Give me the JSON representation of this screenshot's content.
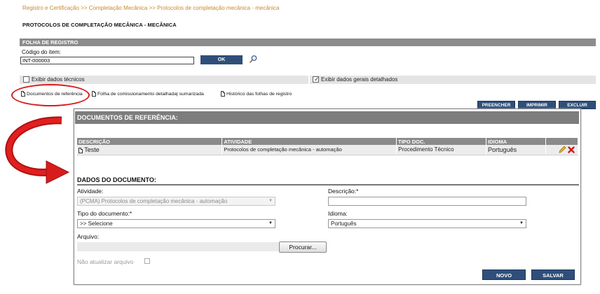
{
  "breadcrumb": {
    "item1": "Registro e Certificação",
    "sep": ">>",
    "item2": "Completação Mecânica",
    "item3": "Protocolos de completação mecânica - mecânica"
  },
  "page_title": "PROTOCOLOS DE COMPLETAÇÃO MECÂNICA - MECÂNICA",
  "folha": {
    "title": "FOLHA DE REGISTRO",
    "codigo_label": "Código do item:",
    "codigo_value": "INT-000003",
    "ok_label": "OK"
  },
  "options": {
    "tech_label": "Exibir dados técnicos",
    "tech_checked": false,
    "general_label": "Exibir dados gerais detalhados",
    "general_checked": true
  },
  "tabs": [
    {
      "label": "Documentos de referência"
    },
    {
      "label": "Folha de comissionamento detalhada| sumarizada"
    },
    {
      "label": "Histórico das folhas de registro"
    }
  ],
  "actions": {
    "preencher": "PREENCHER",
    "imprimir": "IMPRIMIR",
    "excluir": "EXCLUIR"
  },
  "panel": {
    "title": "DOCUMENTOS DE REFERÊNCIA:",
    "columns": [
      "DESCRIÇÃO",
      "ATIVIDADE",
      "TIPO DOC.",
      "IDIOMA"
    ],
    "rows": [
      {
        "descricao": "Teste",
        "atividade": "Protocolos de completação mecânica - automação",
        "tipo": "Procedimento Técnico",
        "idioma": "Português"
      }
    ]
  },
  "dados": {
    "title": "DADOS DO DOCUMENTO:",
    "atividade_label": "Atividade:",
    "atividade_value": "(PCMA) Protocolos de completação mecânica - automação",
    "descricao_label": "Descrição:*",
    "descricao_value": "",
    "tipo_label": "Tipo do documento:*",
    "tipo_value": ">> Selecione",
    "idioma_label": "Idioma:",
    "idioma_value": "Português",
    "arquivo_label": "Arquivo:",
    "procurar_label": "Procurar...",
    "nao_atualizar_label": "Não atualizar arquivo",
    "novo_label": "NOVO",
    "salvar_label": "SALVAR"
  },
  "colors": {
    "breadcrumb": "#c78a2c",
    "button_dark": "#2f4f7a",
    "header_gray": "#7d7d7d",
    "highlight_red": "#d81c1c"
  },
  "icons": [
    "search-icon",
    "doc-icon",
    "edit-icon",
    "delete-icon",
    "chevron-down-icon"
  ]
}
